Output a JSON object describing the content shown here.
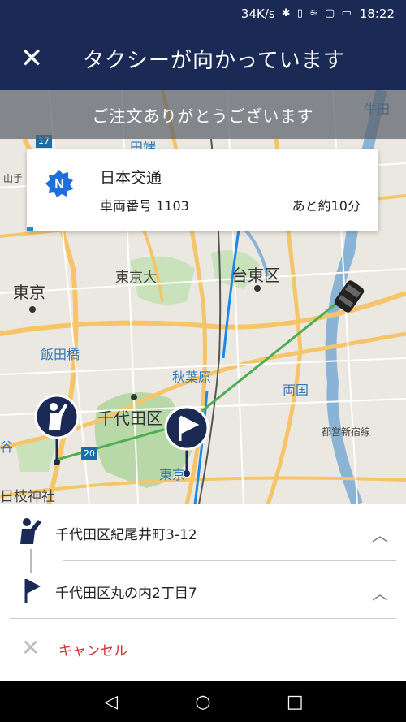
{
  "status_bar": {
    "speed": "34K/s",
    "icons": "✱ ▯ ≋ ▢ ▭",
    "time": "18:22"
  },
  "app_bar": {
    "close_icon": "close-icon",
    "title": "タクシーが向かっています"
  },
  "banner": {
    "text": "ご注文ありがとうございます"
  },
  "driver_card": {
    "company": "日本交通",
    "car_number": "車両番号 1103",
    "eta": "あと約10分",
    "logo_icon": "n-logo-icon"
  },
  "map": {
    "labels": {
      "tokyo": "東京",
      "taito": "台東区",
      "chiyoda": "千代田区",
      "tokyo_univ": "東京大",
      "iidabashi": "飯田橋",
      "akihabara": "秋葉原",
      "ryogoku": "両国",
      "tabata": "田端",
      "ushijima": "牛田",
      "tokyo_sta": "東京",
      "hie": "日枝神社",
      "shin_ohashi": "都営新宿線",
      "route_17": "17",
      "route_20": "20",
      "yamate": "山手",
      "tani": "谷"
    },
    "colors": {
      "route_line": "#4caf50",
      "pin": "#1b2a55",
      "water": "#8ab4d6",
      "park": "#b8d8a8",
      "road": "#f6c56a"
    }
  },
  "route_panel": {
    "pickup": {
      "address": "千代田区紀尾井町3-12",
      "icon": "person-waving-icon"
    },
    "dropoff": {
      "address": "千代田区丸の内2丁目7",
      "icon": "flag-icon"
    },
    "chevron": "︿",
    "cancel": {
      "label": "キャンセル",
      "icon": "✕"
    }
  },
  "nav_bar": {
    "back": "◁",
    "home": "○",
    "recents": "□"
  }
}
